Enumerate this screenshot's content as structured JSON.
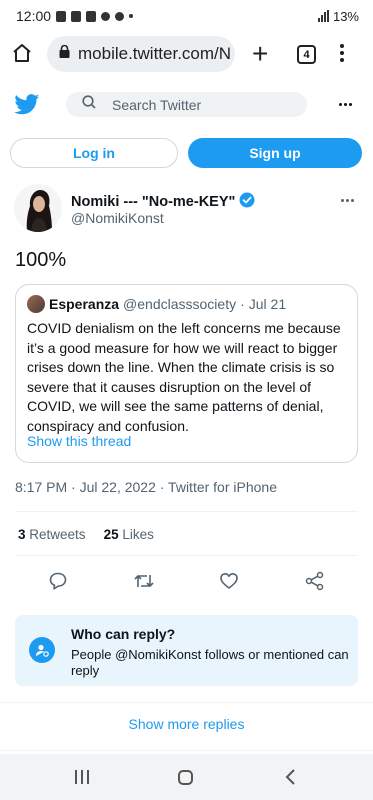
{
  "status_bar": {
    "time": "12:00",
    "battery": "13%"
  },
  "browser": {
    "url": "mobile.twitter.com/N",
    "tab_count": "4"
  },
  "twitter": {
    "search_placeholder": "Search Twitter",
    "login_label": "Log in",
    "signup_label": "Sign up"
  },
  "tweet": {
    "author_name": "Nomiki --- \"No-me-KEY\"",
    "author_handle": "@NomikiKonst",
    "verified": true,
    "text": "100%",
    "quote": {
      "name": "Esperanza",
      "handle": "@endclasssociety",
      "separator": "·",
      "date": "Jul 21",
      "text": "COVID denialism on the left concerns me because it’s a good measure for how we will react to bigger crises down the line. When the climate crisis is so severe that it causes disruption on the level of COVID, we will see the same patterns of denial, conspiracy and confusion.",
      "link": "Show this thread"
    },
    "meta": "8:17 PM · Jul 22, 2022 · Twitter for iPhone",
    "retweets_count": "3",
    "retweets_label": "Retweets",
    "likes_count": "25",
    "likes_label": "Likes"
  },
  "reply_settings": {
    "title": "Who can reply?",
    "description": "People @NomikiKonst follows or mentioned can reply"
  },
  "show_more": "Show more replies",
  "colors": {
    "accent": "#1d9bf0",
    "text": "#0f1419",
    "muted": "#536471"
  }
}
